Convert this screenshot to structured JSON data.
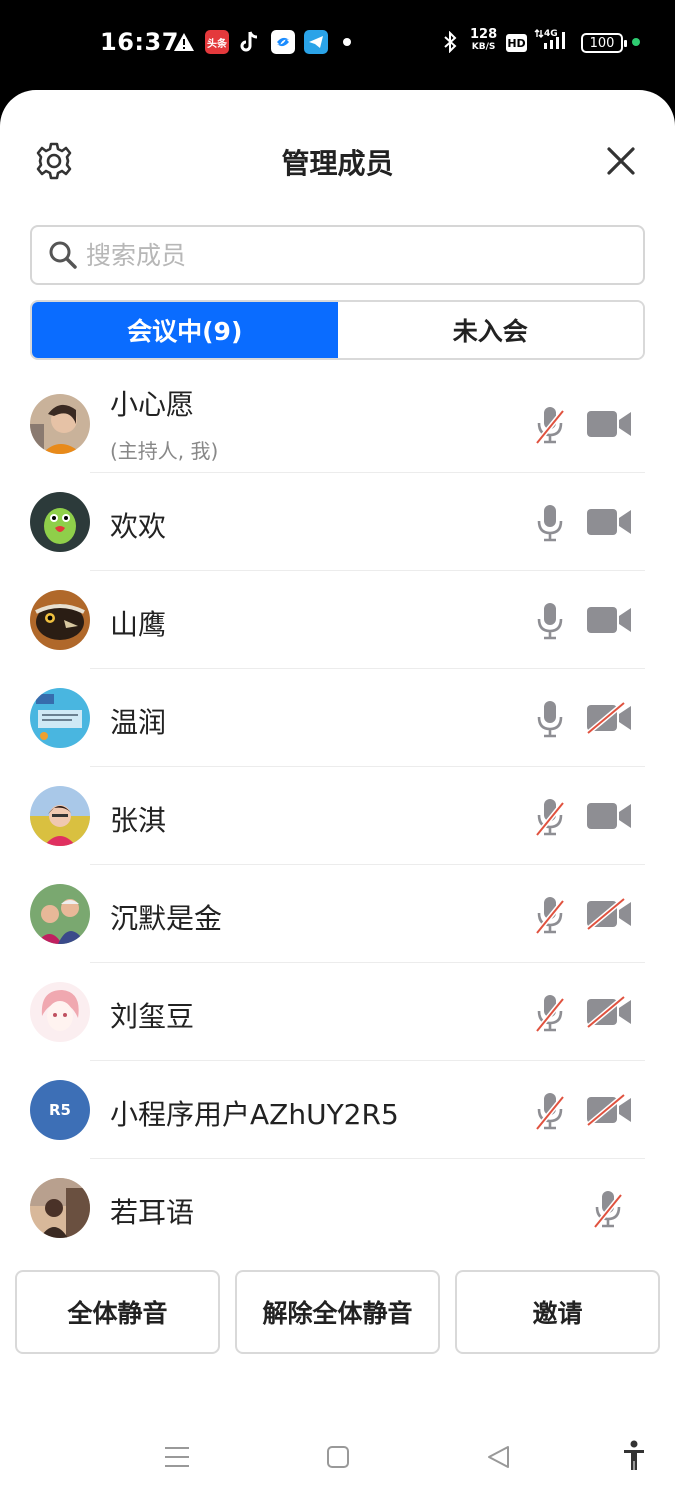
{
  "status_bar": {
    "time": "16:37",
    "speed_value": "128",
    "speed_unit": "KB/S",
    "hd_label": "HD",
    "network": "4G",
    "battery": "100",
    "app_toutiao": "头条"
  },
  "header": {
    "title": "管理成员"
  },
  "search": {
    "placeholder": "搜索成员"
  },
  "tabs": {
    "in_meeting": "会议中(9)",
    "not_joined": "未入会"
  },
  "members": [
    {
      "name": "小心愿",
      "sub": "(主持人, 我)",
      "mic": "muted",
      "camera": "on"
    },
    {
      "name": "欢欢",
      "sub": "",
      "mic": "on",
      "camera": "on"
    },
    {
      "name": "山鹰",
      "sub": "",
      "mic": "on",
      "camera": "on"
    },
    {
      "name": "温润",
      "sub": "",
      "mic": "on",
      "camera": "off"
    },
    {
      "name": "张淇",
      "sub": "",
      "mic": "muted",
      "camera": "on"
    },
    {
      "name": "沉默是金",
      "sub": "",
      "mic": "muted",
      "camera": "off"
    },
    {
      "name": "刘玺豆",
      "sub": "",
      "mic": "muted",
      "camera": "off"
    },
    {
      "name": "小程序用户AZhUY2R5",
      "sub": "",
      "avatar_text": "R5",
      "mic": "muted",
      "camera": "off"
    },
    {
      "name": "若耳语",
      "sub": "",
      "mic": "muted",
      "camera": "none"
    }
  ],
  "actions": {
    "mute_all": "全体静音",
    "unmute_all": "解除全体静音",
    "invite": "邀请"
  },
  "colors": {
    "accent": "#0a6cff",
    "mute_slash": "#e0523f",
    "icon_gray": "#8e8e93"
  }
}
